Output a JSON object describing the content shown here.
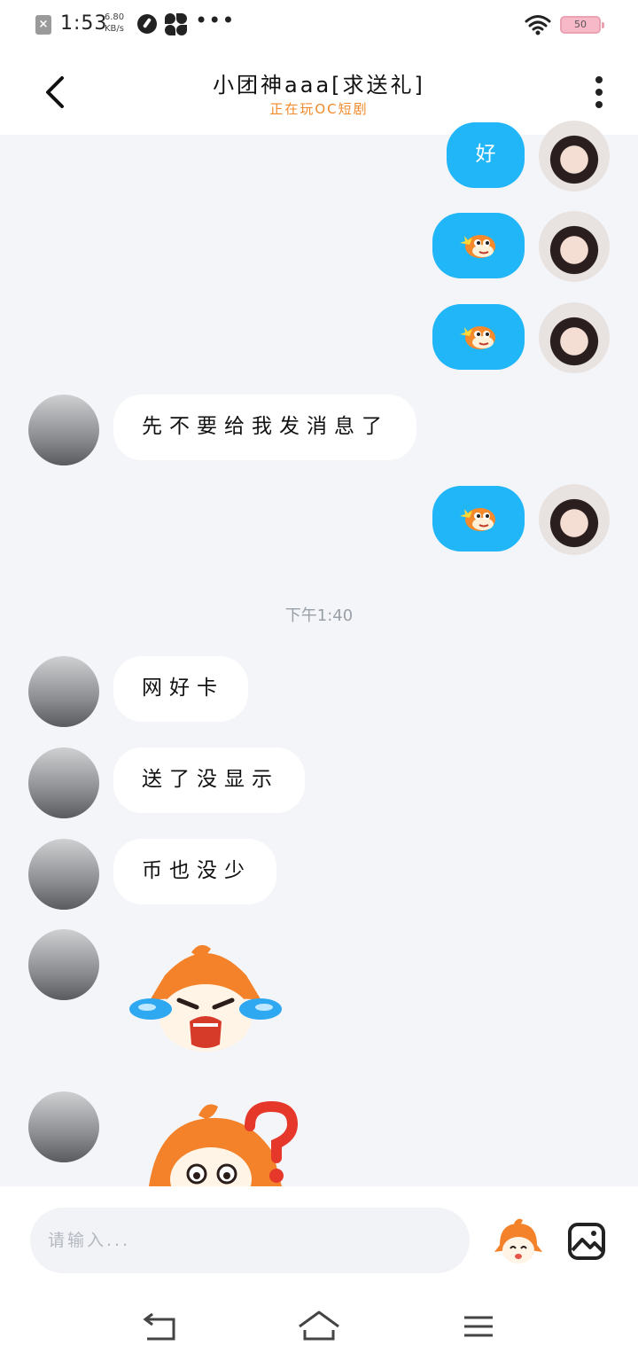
{
  "status_bar": {
    "time": "1:53",
    "net_speed_value": "6.80",
    "net_speed_unit": "KB/s",
    "battery": "50"
  },
  "header": {
    "title": "小团神aaa[求送礼]",
    "subtitle": "正在玩OC短剧"
  },
  "messages": [
    {
      "side": "right",
      "text": "好"
    },
    {
      "side": "right",
      "sticker": "fish-emoji"
    },
    {
      "side": "right",
      "sticker": "fish-emoji"
    },
    {
      "side": "left",
      "text": "先不要给我发消息了"
    },
    {
      "side": "right",
      "sticker": "fish-emoji"
    },
    {
      "side": "left",
      "text": "网好卡"
    },
    {
      "side": "left",
      "text": "送了没显示"
    },
    {
      "side": "left",
      "text": "币也没少"
    },
    {
      "side": "left",
      "sticker": "crying-mascot-sticker"
    },
    {
      "side": "left",
      "sticker": "confused-mascot-sticker"
    }
  ],
  "timestamp": "下午1:40",
  "input": {
    "placeholder": "请输入..."
  },
  "colors": {
    "accent_blue": "#21b6f7",
    "subtitle_orange": "#f08a2b",
    "background": "#f4f5f9"
  },
  "icons": [
    "back-arrow-icon",
    "more-vertical-icon",
    "emoji-mascot-icon",
    "image-icon",
    "nav-back-icon",
    "nav-home-icon",
    "nav-menu-icon"
  ]
}
